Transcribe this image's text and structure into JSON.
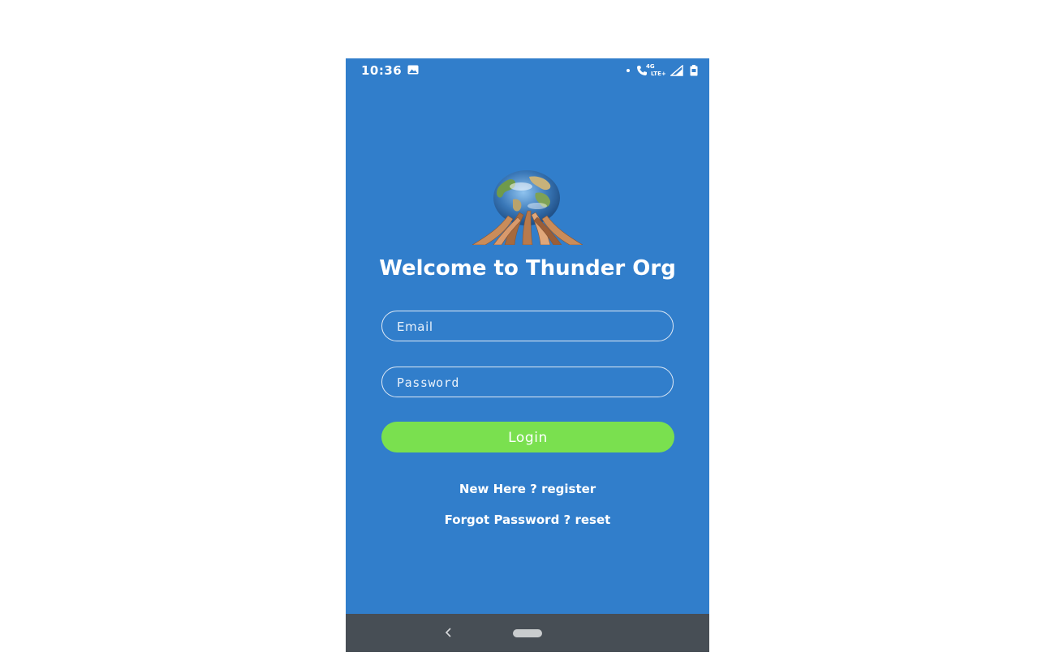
{
  "status_bar": {
    "time": "10:36",
    "image_icon": "image-icon",
    "network_top": "4G",
    "network_bottom": "LTE+",
    "call_icon": "wifi-call-icon",
    "signal_icon": "signal-icon",
    "battery_icon": "battery-icon"
  },
  "logo": {
    "icon": "globe-hands-logo"
  },
  "welcome": {
    "title": "Welcome to Thunder Org"
  },
  "form": {
    "email_placeholder": "Email",
    "password_placeholder": "Password",
    "login_label": "Login"
  },
  "links": {
    "register": "New Here ? register",
    "reset": "Forgot Password ? reset"
  },
  "nav": {
    "back_icon": "chevron-left-icon",
    "home_icon": "home-pill-icon"
  },
  "colors": {
    "background": "#317ecb",
    "button": "#7ae04f",
    "nav_bar": "#474e55"
  }
}
